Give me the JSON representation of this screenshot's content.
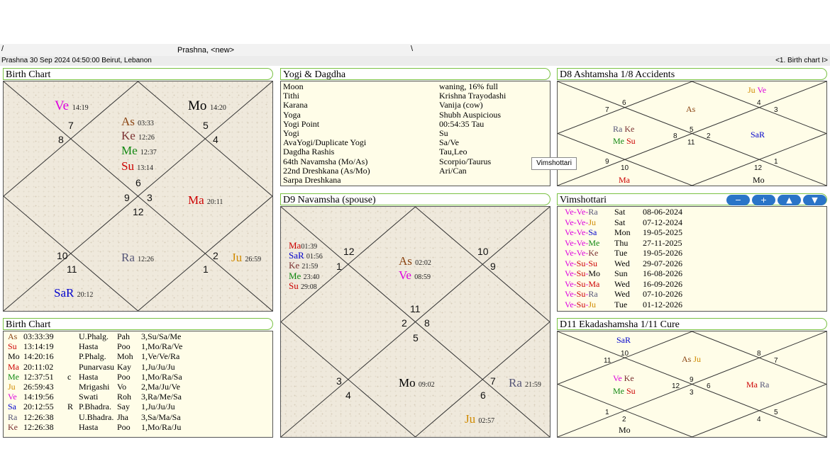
{
  "window": {
    "tab_title": "Prashna,  <new>"
  },
  "status": {
    "left": "Prashna 30 Sep 2024 04:50:00  Beirut, Lebanon",
    "right": "<1. Birth chart I>"
  },
  "colors": {
    "As": "#8b4513",
    "Su": "#cc0000",
    "Mo": "#000000",
    "Ma": "#cc0000",
    "Me": "#118811",
    "Ju": "#d08a00",
    "Ve": "#dd00dd",
    "Sa": "#0000cc",
    "Ra": "#555577",
    "Ke": "#7a3030",
    "accent": "#7ac143",
    "button": "#2a74c8"
  },
  "birth_chart": {
    "title": "Birth Chart",
    "planets": [
      {
        "name": "Ve",
        "deg": "14:19",
        "c": "Ve"
      },
      {
        "name": "Mo",
        "deg": "14:20",
        "c": "Mo"
      },
      {
        "name": "As",
        "deg": "03:33",
        "c": "As"
      },
      {
        "name": "Ke",
        "deg": "12:26",
        "c": "Ke"
      },
      {
        "name": "Me",
        "deg": "12:37",
        "c": "Me"
      },
      {
        "name": "Su",
        "deg": "13:14",
        "c": "Su"
      },
      {
        "name": "Ma",
        "deg": "20:11",
        "c": "Ma"
      },
      {
        "name": "Ra",
        "deg": "12:26",
        "c": "Ra"
      },
      {
        "name": "Ju",
        "deg": "26:59",
        "c": "Ju"
      },
      {
        "name": "SaR",
        "deg": "20:12",
        "c": "Sa"
      }
    ],
    "houses": [
      "7",
      "5",
      "8",
      "4",
      "6",
      "9",
      "3",
      "12",
      "10",
      "2",
      "11",
      "1"
    ]
  },
  "yogi": {
    "title": "Yogi & Dagdha",
    "rows": [
      {
        "k": "Moon",
        "v": "waning, 16% full"
      },
      {
        "k": "Tithi",
        "v": "Krishna Trayodashi"
      },
      {
        "k": "Karana",
        "v": "Vanija (cow)"
      },
      {
        "k": "Yoga",
        "v": "Shubh Auspicious"
      },
      {
        "k": "Yogi Point",
        "v": "00:54:35 Tau"
      },
      {
        "k": "Yogi",
        "v": "Su"
      },
      {
        "k": "AvaYogi/Duplicate Yogi",
        "v": "Sa/Ve"
      },
      {
        "k": "Dagdha Rashis",
        "v": "Tau,Leo"
      },
      {
        "k": "64th Navamsha (Mo/As)",
        "v": "Scorpio/Taurus"
      },
      {
        "k": "22nd Dreshkana (As/Mo)",
        "v": "Ari/Can"
      },
      {
        "k": "Sarpa Dreshkana",
        "v": ""
      }
    ]
  },
  "d8": {
    "title": "D8 Ashtamsha 1/8  Accidents",
    "houses": [
      "6",
      "4",
      "7",
      "3",
      "5",
      "8",
      "2",
      "11",
      "9",
      "1",
      "10",
      "12"
    ],
    "planets": [
      {
        "name": "Ju",
        "c": "Ju"
      },
      {
        "name": "Ve",
        "c": "Ve"
      },
      {
        "name": "As",
        "c": "As"
      },
      {
        "name": "Ra",
        "c": "Ra"
      },
      {
        "name": "Ke",
        "c": "Ke"
      },
      {
        "name": "Me",
        "c": "Me"
      },
      {
        "name": "Su",
        "c": "Su"
      },
      {
        "name": "SaR",
        "c": "Sa"
      },
      {
        "name": "Ma",
        "c": "Ma"
      },
      {
        "name": "Mo",
        "c": "Mo"
      }
    ]
  },
  "tooltip": "Vimshottari",
  "d9": {
    "title": "D9 Navamsha  (spouse)",
    "houses": [
      "12",
      "10",
      "1",
      "9",
      "11",
      "2",
      "8",
      "5",
      "3",
      "7",
      "4",
      "6"
    ],
    "planets": [
      {
        "name": "Ma",
        "deg": "01:39",
        "c": "Ma"
      },
      {
        "name": "SaR",
        "deg": "01:56",
        "c": "Sa"
      },
      {
        "name": "Ke",
        "deg": "21:59",
        "c": "Ke"
      },
      {
        "name": "Me",
        "deg": "23:40",
        "c": "Me"
      },
      {
        "name": "Su",
        "deg": "29:08",
        "c": "Su"
      },
      {
        "name": "As",
        "deg": "02:02",
        "c": "As"
      },
      {
        "name": "Ve",
        "deg": "08:59",
        "c": "Ve"
      },
      {
        "name": "Mo",
        "deg": "09:02",
        "c": "Mo"
      },
      {
        "name": "Ra",
        "deg": "21:59",
        "c": "Ra"
      },
      {
        "name": "Ju",
        "deg": "02:57",
        "c": "Ju"
      }
    ]
  },
  "vimshottari": {
    "title": "Vimshottari",
    "buttons": [
      "−",
      "+",
      "▲",
      "▼"
    ],
    "rows": [
      {
        "p": [
          [
            "Ve",
            "Ve"
          ],
          [
            "Ve",
            "Ve"
          ],
          [
            "Ra",
            "Ra"
          ]
        ],
        "day": "Sat",
        "date": "08-06-2024"
      },
      {
        "p": [
          [
            "Ve",
            "Ve"
          ],
          [
            "Ve",
            "Ve"
          ],
          [
            "Ju",
            "Ju"
          ]
        ],
        "day": "Sat",
        "date": "07-12-2024"
      },
      {
        "p": [
          [
            "Ve",
            "Ve"
          ],
          [
            "Ve",
            "Ve"
          ],
          [
            "Sa",
            "Sa"
          ]
        ],
        "day": "Mon",
        "date": "19-05-2025"
      },
      {
        "p": [
          [
            "Ve",
            "Ve"
          ],
          [
            "Ve",
            "Ve"
          ],
          [
            "Me",
            "Me"
          ]
        ],
        "day": "Thu",
        "date": "27-11-2025"
      },
      {
        "p": [
          [
            "Ve",
            "Ve"
          ],
          [
            "Ve",
            "Ve"
          ],
          [
            "Ke",
            "Ke"
          ]
        ],
        "day": "Tue",
        "date": "19-05-2026"
      },
      {
        "p": [
          [
            "Ve",
            "Ve"
          ],
          [
            "Su",
            "Su"
          ],
          [
            "Su",
            "Su"
          ]
        ],
        "day": "Wed",
        "date": "29-07-2026"
      },
      {
        "p": [
          [
            "Ve",
            "Ve"
          ],
          [
            "Su",
            "Su"
          ],
          [
            "Mo",
            "Mo"
          ]
        ],
        "day": "Sun",
        "date": "16-08-2026"
      },
      {
        "p": [
          [
            "Ve",
            "Ve"
          ],
          [
            "Su",
            "Su"
          ],
          [
            "Ma",
            "Ma"
          ]
        ],
        "day": "Wed",
        "date": "16-09-2026"
      },
      {
        "p": [
          [
            "Ve",
            "Ve"
          ],
          [
            "Su",
            "Su"
          ],
          [
            "Ra",
            "Ra"
          ]
        ],
        "day": "Wed",
        "date": "07-10-2026"
      },
      {
        "p": [
          [
            "Ve",
            "Ve"
          ],
          [
            "Su",
            "Su"
          ],
          [
            "Ju",
            "Ju"
          ]
        ],
        "day": "Tue",
        "date": "01-12-2026"
      }
    ]
  },
  "birth_table": {
    "title": "Birth Chart",
    "rows": [
      {
        "p": "As",
        "c": "As",
        "deg": "03:33:39",
        "r": "",
        "nak": "U.Phalg.",
        "pada": "Pah",
        "lord": "3,Su/Sa/Me"
      },
      {
        "p": "Su",
        "c": "Su",
        "deg": "13:14:19",
        "r": "",
        "nak": "Hasta",
        "pada": "Poo",
        "lord": "1,Mo/Ra/Ve"
      },
      {
        "p": "Mo",
        "c": "Mo",
        "deg": "14:20:16",
        "r": "",
        "nak": "P.Phalg.",
        "pada": "Moh",
        "lord": "1,Ve/Ve/Ra"
      },
      {
        "p": "Ma",
        "c": "Ma",
        "deg": "20:11:02",
        "r": "",
        "nak": "Punarvasu",
        "pada": "Kay",
        "lord": "1,Ju/Ju/Ju"
      },
      {
        "p": "Me",
        "c": "Me",
        "deg": "12:37:51",
        "r": "c",
        "nak": "Hasta",
        "pada": "Poo",
        "lord": "1,Mo/Ra/Sa"
      },
      {
        "p": "Ju",
        "c": "Ju",
        "deg": "26:59:43",
        "r": "",
        "nak": "Mrigashi",
        "pada": "Vo",
        "lord": "2,Ma/Ju/Ve"
      },
      {
        "p": "Ve",
        "c": "Ve",
        "deg": "14:19:56",
        "r": "",
        "nak": "Swati",
        "pada": "Roh",
        "lord": "3,Ra/Me/Sa"
      },
      {
        "p": "Sa",
        "c": "Sa",
        "deg": "20:12:55",
        "r": "R",
        "nak": "P.Bhadra.",
        "pada": "Say",
        "lord": "1,Ju/Ju/Ju"
      },
      {
        "p": "Ra",
        "c": "Ra",
        "deg": "12:26:38",
        "r": "",
        "nak": "U.Bhadra.",
        "pada": "Jha",
        "lord": "3,Sa/Ma/Sa"
      },
      {
        "p": "Ke",
        "c": "Ke",
        "deg": "12:26:38",
        "r": "",
        "nak": "Hasta",
        "pada": "Poo",
        "lord": "1,Mo/Ra/Ju"
      }
    ]
  },
  "d11": {
    "title": "D11 Ekadashamsha 1/11  Cure",
    "houses": [
      "10",
      "8",
      "11",
      "7",
      "9",
      "12",
      "6",
      "3",
      "1",
      "5",
      "2",
      "4"
    ],
    "planets": [
      {
        "name": "SaR",
        "c": "Sa"
      },
      {
        "name": "As",
        "c": "As"
      },
      {
        "name": "Ju",
        "c": "Ju"
      },
      {
        "name": "Ve",
        "c": "Ve"
      },
      {
        "name": "Ke",
        "c": "Ke"
      },
      {
        "name": "Me",
        "c": "Me"
      },
      {
        "name": "Su",
        "c": "Su"
      },
      {
        "name": "Ma",
        "c": "Ma"
      },
      {
        "name": "Ra",
        "c": "Ra"
      },
      {
        "name": "Mo",
        "c": "Mo"
      }
    ]
  }
}
